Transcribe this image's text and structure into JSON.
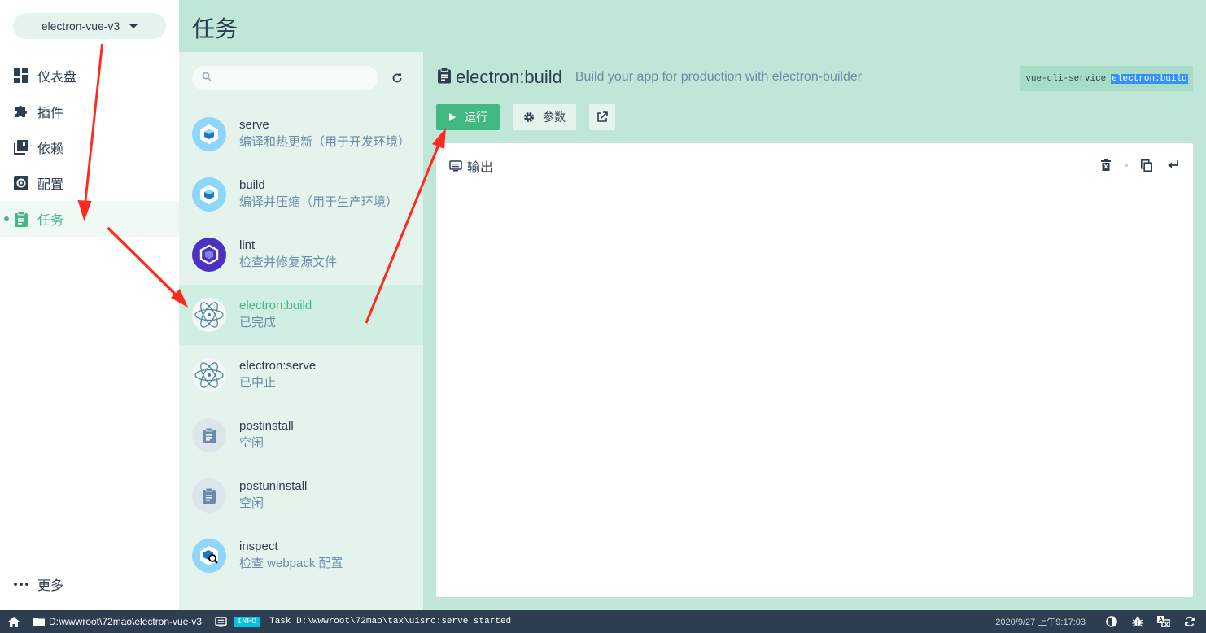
{
  "project": {
    "name": "electron-vue-v3"
  },
  "sidebar": {
    "items": [
      {
        "label": "仪表盘",
        "icon": "dashboard-icon"
      },
      {
        "label": "插件",
        "icon": "puzzle-icon"
      },
      {
        "label": "依赖",
        "icon": "library-icon"
      },
      {
        "label": "配置",
        "icon": "settings-icon"
      },
      {
        "label": "任务",
        "icon": "clipboard-icon",
        "active": true
      }
    ],
    "more_label": "更多"
  },
  "header": {
    "title": "任务"
  },
  "search": {
    "placeholder": ""
  },
  "tasks": [
    {
      "name": "serve",
      "desc": "编译和热更新（用于开发环境）",
      "icon": "webpack-icon"
    },
    {
      "name": "build",
      "desc": "编译并压缩（用于生产环境）",
      "icon": "webpack-icon"
    },
    {
      "name": "lint",
      "desc": "检查并修复源文件",
      "icon": "eslint-icon"
    },
    {
      "name": "electron:build",
      "desc": "已完成",
      "icon": "electron-icon",
      "active": true
    },
    {
      "name": "electron:serve",
      "desc": "已中止",
      "icon": "electron-icon"
    },
    {
      "name": "postinstall",
      "desc": "空闲",
      "icon": "clipboard-icon"
    },
    {
      "name": "postuninstall",
      "desc": "空闲",
      "icon": "clipboard-icon"
    },
    {
      "name": "inspect",
      "desc": "检查 webpack 配置",
      "icon": "webpack-inspect-icon"
    }
  ],
  "detail": {
    "title": "electron:build",
    "subtitle": "Build your app for production with electron-builder",
    "command_prefix": "vue-cli-service",
    "command_arg": "electron:build",
    "run_label": "运行",
    "params_label": "参数",
    "output_label": "输出"
  },
  "statusbar": {
    "path": "D:\\wwwroot\\72mao\\electron-vue-v3",
    "log_level": "INFO",
    "log_message": "Task D:\\wwwroot\\72mao\\tax\\uisrc:serve started",
    "time": "2020/9/27 上午9:17:03"
  },
  "colors": {
    "accent": "#42b983",
    "header": "#bfe6d6",
    "list": "#e4f4ec",
    "statusbar": "#2c3e50",
    "annotation": "#ff2a1f"
  }
}
